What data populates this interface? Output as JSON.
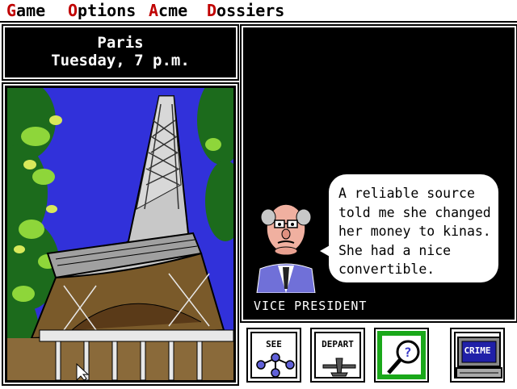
{
  "menu": [
    {
      "hot": "G",
      "rest": "ame"
    },
    {
      "hot": "O",
      "rest": "ptions"
    },
    {
      "hot": "A",
      "rest": "cme"
    },
    {
      "hot": "D",
      "rest": "ossiers"
    }
  ],
  "location": {
    "city": "Paris",
    "time": "Tuesday, 7 p.m."
  },
  "witness": {
    "title": "VICE PRESIDENT",
    "quote": "A reliable source\ntold me she changed\nher money to kinas.\nShe had a nice\nconvertible."
  },
  "buttons": {
    "see": "SEE",
    "depart": "DEPART",
    "crime": "CRIME"
  },
  "colors": {
    "menu_hotkey": "#c00000",
    "active_button": "#1aa81a",
    "sky": "#1a1aa8"
  },
  "icons": [
    "see-connections-icon",
    "airplane-icon",
    "magnifier-question-icon",
    "computer-crime-icon",
    "mouse-cursor-icon"
  ]
}
